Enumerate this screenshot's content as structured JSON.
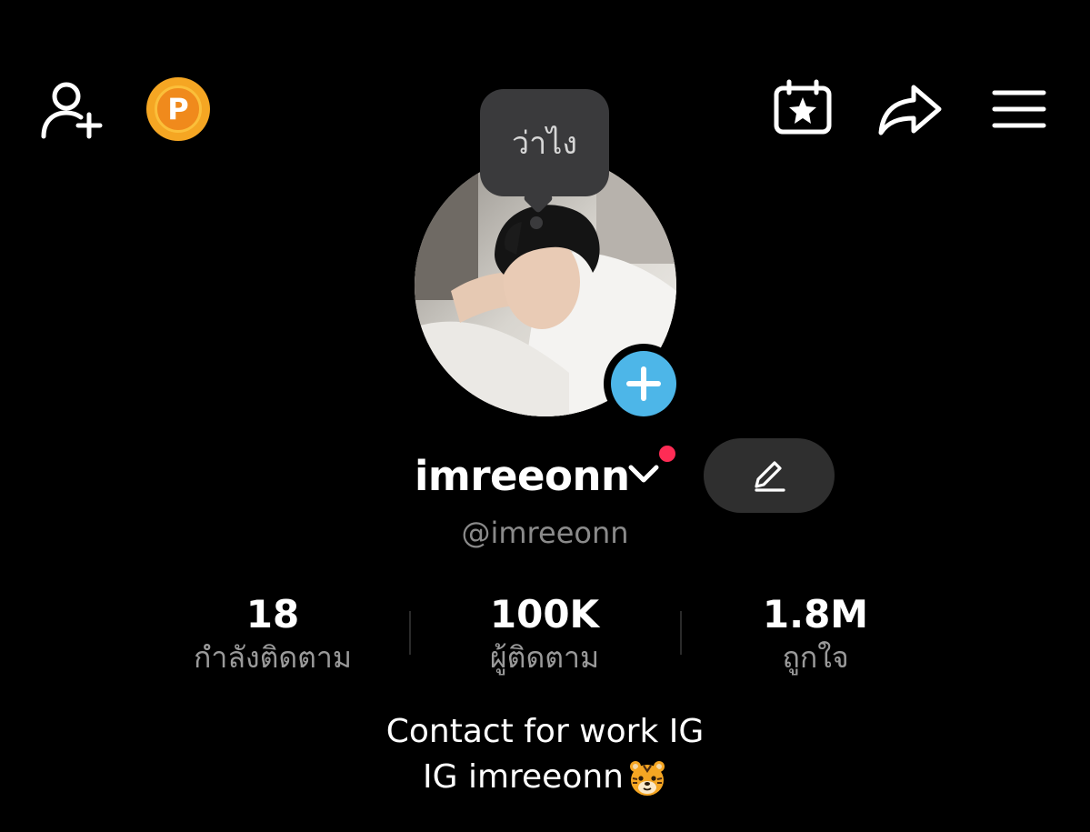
{
  "header": {
    "coin_letter": "P",
    "icons": [
      "add-friend-icon",
      "coin-icon",
      "event-calendar-icon",
      "share-icon",
      "menu-icon"
    ]
  },
  "bubble": {
    "text": "ว่าไง"
  },
  "profile": {
    "display_name": "imreeonn",
    "username": "@imreeonn"
  },
  "stats": [
    {
      "value": "18",
      "label": "กำลังติดตาม"
    },
    {
      "value": "100K",
      "label": "ผู้ติดตาม"
    },
    {
      "value": "1.8M",
      "label": "ถูกใจ"
    }
  ],
  "bio": {
    "line1": "Contact for work IG",
    "line2": "IG imreeonn"
  },
  "colors": {
    "background": "#000000",
    "accent_blue": "#4db6e8",
    "notification_red": "#fe2c55",
    "coin": "#f5a623"
  }
}
